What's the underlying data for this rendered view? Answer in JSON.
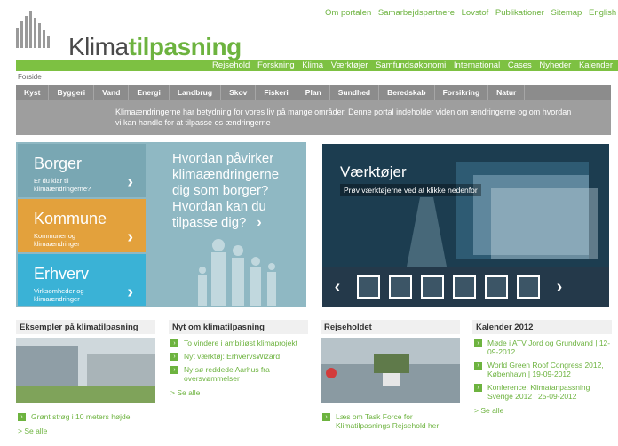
{
  "header": {
    "logo_prefix": "Klima",
    "logo_suffix": "tilpasning",
    "top_links": [
      "Om portalen",
      "Samarbejdspartnere",
      "Lovstof",
      "Publikationer",
      "Sitemap",
      "English"
    ]
  },
  "main_nav": [
    "Rejsehold",
    "Forskning",
    "Klima",
    "Værktøjer",
    "Samfundsøkonomi",
    "International",
    "Cases",
    "Nyheder",
    "Kalender"
  ],
  "breadcrumb": "Forside",
  "topics": [
    "Kyst",
    "Byggeri",
    "Vand",
    "Energi",
    "Landbrug",
    "Skov",
    "Fiskeri",
    "Plan",
    "Sundhed",
    "Beredskab",
    "Forsikring",
    "Natur"
  ],
  "intro": "Klimaændringerne har betydning for vores liv på mange områder. Denne portal indeholder viden om ændringerne og om hvordan vi kan handle for at tilpasse os ændringerne",
  "audience": {
    "tiles": [
      {
        "title": "Borger",
        "subtitle": "Er du klar til klimaændringerne?"
      },
      {
        "title": "Kommune",
        "subtitle": "Kommuner og klimaændringer"
      },
      {
        "title": "Erhverv",
        "subtitle": "Virksomheder og klimaændringer"
      }
    ],
    "question": "Hvordan påvirker klimaændringerne dig som borger? Hvordan kan du tilpasse dig?"
  },
  "tools": {
    "title": "Værktøjer",
    "subtitle": "Prøv værktøjerne ved at klikke nedenfor",
    "icons": [
      "factory-icon",
      "house-icon",
      "flood-icon",
      "hand-icon",
      "gauge-icon",
      "document-icon"
    ]
  },
  "columns": [
    {
      "heading": "Eksempler på klimatilpasning",
      "items": [
        "Grønt strøg i 10 meters højde"
      ],
      "more": "> Se alle"
    },
    {
      "heading": "Nyt om klimatilpasning",
      "items": [
        "To vindere i ambitiøst klimaprojekt",
        "Nyt værktøj: ErhvervsWizard",
        "Ny sø reddede Aarhus fra oversvømmelser"
      ],
      "more": "> Se alle"
    },
    {
      "heading": "Rejseholdet",
      "items": [
        "Læs om Task Force for Klimatilpasnings Rejsehold her"
      ],
      "more": ""
    },
    {
      "heading": "Kalender 2012",
      "items": [
        "Møde i ATV Jord og Grundvand | 12-09-2012",
        "World Green Roof Congress 2012, København | 19-09-2012",
        "Konference: Klimatanpassning Sverige 2012 | 25-09-2012"
      ],
      "more": "> Se alle"
    }
  ],
  "colors": {
    "green": "#7dc142",
    "dark_teal": "#1c3d50",
    "orange": "#e3a13c",
    "blue": "#3ab2d6"
  }
}
